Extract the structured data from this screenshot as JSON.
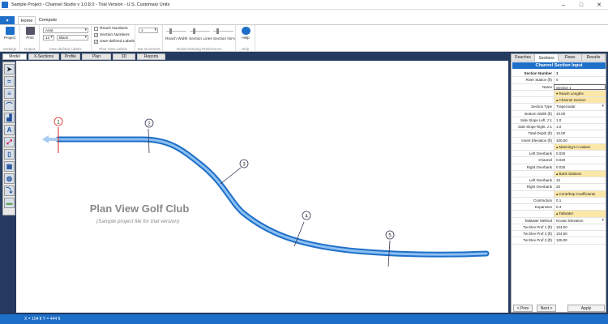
{
  "window": {
    "title": "Sample Project - Channel Studio v 1.0.8.0 - Trial Version - U.S. Customary Units"
  },
  "ribbon": {
    "tabs": [
      "Home",
      "Compute"
    ],
    "settings": {
      "project": "Project",
      "label": "Settings"
    },
    "output": {
      "print": "Print",
      "label": "Output"
    },
    "font": {
      "family": "Arial",
      "size": "12",
      "color": "Black",
      "label": "User-defined Labels"
    },
    "plan_labels": {
      "items": [
        {
          "label": "Reach Numbers",
          "checked": false
        },
        {
          "label": "Section Numbers",
          "checked": true
        },
        {
          "label": "User-defined Labels",
          "checked": true
        }
      ],
      "label": "Plan View Labels"
    },
    "sta": {
      "value": "1",
      "label": "Sta Increment"
    },
    "drawing": {
      "reach_width": "Reach Width",
      "section_lines": "Section Lines",
      "section_nos": "Section No's",
      "label": "Model Drawing Preferences"
    },
    "help": {
      "button": "Help",
      "label": "Help"
    }
  },
  "view_tabs": [
    "Model",
    "X-Sections",
    "Profile",
    "Plan",
    "3D",
    "Reports"
  ],
  "canvas": {
    "title": "Plan View Golf Club",
    "subtitle": "(Sample project file for trial version)",
    "sections": [
      "1",
      "2",
      "3",
      "4",
      "5"
    ]
  },
  "status": {
    "coord": "X = 104 ft   Y = 444 ft"
  },
  "panel": {
    "tabs": [
      "Reaches",
      "Sections",
      "Flows",
      "Results"
    ],
    "header": "Channel Section Input",
    "rows": [
      {
        "k": "Section Number",
        "v": "1",
        "type": "hdr"
      },
      {
        "k": "River Station (ft)",
        "v": "0"
      },
      {
        "k": "Name",
        "v": "Section 1",
        "type": "edit"
      },
      {
        "k": "",
        "v": "▾ Reach Lengths",
        "type": "sec"
      },
      {
        "k": "",
        "v": "▴ Channel Section",
        "type": "sec"
      },
      {
        "k": "Section Type",
        "v": "Trapezoidal",
        "type": "dd"
      },
      {
        "k": "Bottom Width (ft)",
        "v": "10.00"
      },
      {
        "k": "Side Slope Left, z:1",
        "v": "1.0"
      },
      {
        "k": "Side Slope Right, z:1",
        "v": "1.0"
      },
      {
        "k": "Total Depth (ft)",
        "v": "10.00"
      },
      {
        "k": "Invert Elevation (ft)",
        "v": "100.00"
      },
      {
        "k": "",
        "v": "▴ Manning's n-values",
        "type": "sec"
      },
      {
        "k": "Left Overbank",
        "v": "0.025"
      },
      {
        "k": "Channel",
        "v": "0.020"
      },
      {
        "k": "Right Overbank",
        "v": "0.025"
      },
      {
        "k": "",
        "v": "▴ Bank Stations",
        "type": "sec"
      },
      {
        "k": "Left Overbank",
        "v": "10"
      },
      {
        "k": "Right Overbank",
        "v": "20"
      },
      {
        "k": "",
        "v": "▴ Contr/Exp Coefficients",
        "type": "sec"
      },
      {
        "k": "Contraction",
        "v": "0.1"
      },
      {
        "k": "Expansion",
        "v": "0.3"
      },
      {
        "k": "",
        "v": "▴ Tailwater",
        "type": "sec"
      },
      {
        "k": "Tailwater Method",
        "v": "Known Elevation",
        "type": "dd"
      },
      {
        "k": "Tw Elev Prof 1 (ft)",
        "v": "104.00"
      },
      {
        "k": "Tw Elev Prof 2 (ft)",
        "v": "104.50"
      },
      {
        "k": "Tw Elev Prof 3 (ft)",
        "v": "105.00"
      }
    ],
    "prev": "< Prev",
    "next": "Next >",
    "apply": "Apply"
  }
}
